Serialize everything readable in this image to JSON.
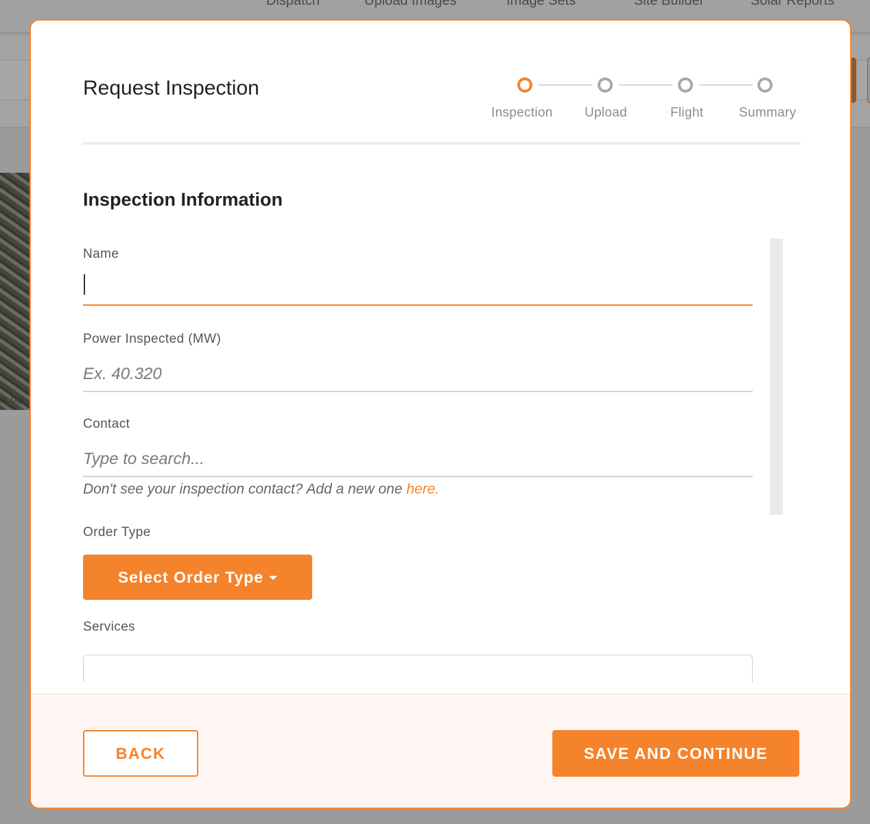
{
  "background": {
    "nav_items": [
      "Dispatch",
      "Upload Images",
      "Image Sets",
      "Site Builder",
      "Solar Reports"
    ],
    "map_credit": "M, Digi"
  },
  "modal": {
    "title": "Request Inspection",
    "steps": [
      {
        "label": "Inspection",
        "active": true
      },
      {
        "label": "Upload",
        "active": false
      },
      {
        "label": "Flight",
        "active": false
      },
      {
        "label": "Summary",
        "active": false
      }
    ],
    "section_title": "Inspection Information",
    "fields": {
      "name": {
        "label": "Name",
        "value": "",
        "placeholder": ""
      },
      "power": {
        "label": "Power Inspected (MW)",
        "value": "",
        "placeholder": "Ex. 40.320"
      },
      "contact": {
        "label": "Contact",
        "value": "",
        "placeholder": "Type to search...",
        "helper_text": "Don't see your inspection contact? Add a new one ",
        "helper_link": "here."
      },
      "order_type": {
        "label": "Order Type",
        "button_label": "Select Order Type"
      },
      "services": {
        "label": "Services"
      }
    },
    "footer": {
      "back_label": "BACK",
      "save_label": "SAVE AND CONTINUE"
    }
  },
  "colors": {
    "accent": "#f5832b",
    "footer_bg": "#fff6f3",
    "overlay": "#9c9c9c"
  }
}
